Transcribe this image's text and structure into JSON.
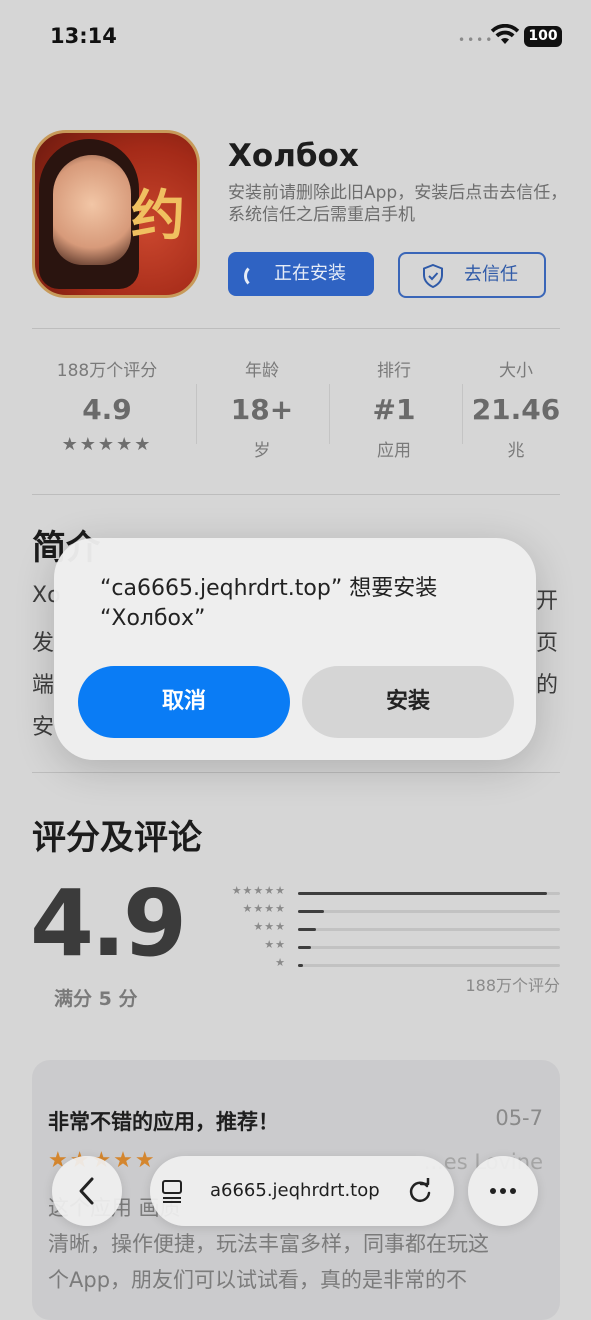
{
  "status": {
    "time": "13:14",
    "battery": "100"
  },
  "app": {
    "icon_glyph": "约",
    "title": "Холбох",
    "subtitle": "安装前请删除此旧App，安装后点击去信任，系统信任之后需重启手机",
    "installing_label": "正在安装",
    "trust_label": "去信任"
  },
  "stats": [
    {
      "label": "188万个评分",
      "value": "4.9",
      "stars": "★★★★★"
    },
    {
      "label": "年龄",
      "value": "18+",
      "unit": "岁"
    },
    {
      "label": "排行",
      "value": "#1",
      "unit": "应用"
    },
    {
      "label": "大小",
      "value": "21.46",
      "unit": "兆"
    }
  ],
  "intro": {
    "heading": "简介",
    "lines_left": [
      "Xo",
      "发",
      "端",
      "安"
    ],
    "lines_right": [
      "开",
      "页",
      "的"
    ]
  },
  "ratings": {
    "heading": "评分及评论",
    "score": "4.9",
    "out_of": "满分 5 分",
    "count": "188万个评分",
    "bars": [
      {
        "stars": "★★★★★",
        "fraction": 0.95
      },
      {
        "stars": "★★★★",
        "fraction": 0.1
      },
      {
        "stars": "★★★",
        "fraction": 0.07
      },
      {
        "stars": "★★",
        "fraction": 0.05
      },
      {
        "stars": "★",
        "fraction": 0.02
      }
    ]
  },
  "review": {
    "title": "非常不错的应用，推荐！",
    "date": "05-7",
    "stars": "★★★★★",
    "author": "...es Lovine",
    "lines": [
      "这个应用                               画质",
      "清晰，操作便捷，玩法丰富多样，同事都在玩这",
      "个App，朋友们可以试试看，真的是非常的不"
    ]
  },
  "dialog": {
    "title": "“ca6665.jeqhrdrt.top” 想要安装 “Холбох”",
    "cancel_label": "取消",
    "install_label": "安装"
  },
  "toolbar": {
    "url": "a6665.jeqhrdrt.top"
  }
}
